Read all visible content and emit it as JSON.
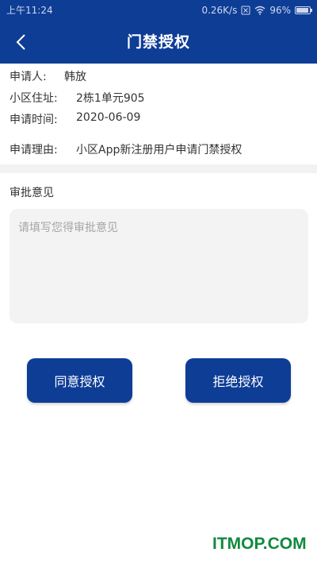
{
  "status_bar": {
    "time": "上午11:24",
    "network_speed": "0.26K/s",
    "battery": "96%",
    "battery_level": 0.96
  },
  "header": {
    "title": "门禁授权",
    "back_icon": "chevron-left-icon"
  },
  "applicant_info": {
    "applicant_label": "申请人:",
    "applicant_value": "韩放",
    "address_label": "小区住址:",
    "address_value": "2栋1单元905",
    "date_label": "申请时间:",
    "date_value": "2020-06-09",
    "reason_label": "申请理由:",
    "reason_value": "小区App新注册用户申请门禁授权"
  },
  "approval": {
    "section_title": "审批意见",
    "comment_placeholder": "请填写您得审批意见",
    "comment_value": ""
  },
  "actions": {
    "agree_label": "同意授权",
    "reject_label": "拒绝授权"
  },
  "watermark": "ITMOP.COM",
  "colors": {
    "primary": "#0e3d96",
    "background": "#ffffff",
    "input_bg": "#f3f3f3",
    "divider": "#f2f2f2",
    "watermark": "#0f8a3f"
  }
}
